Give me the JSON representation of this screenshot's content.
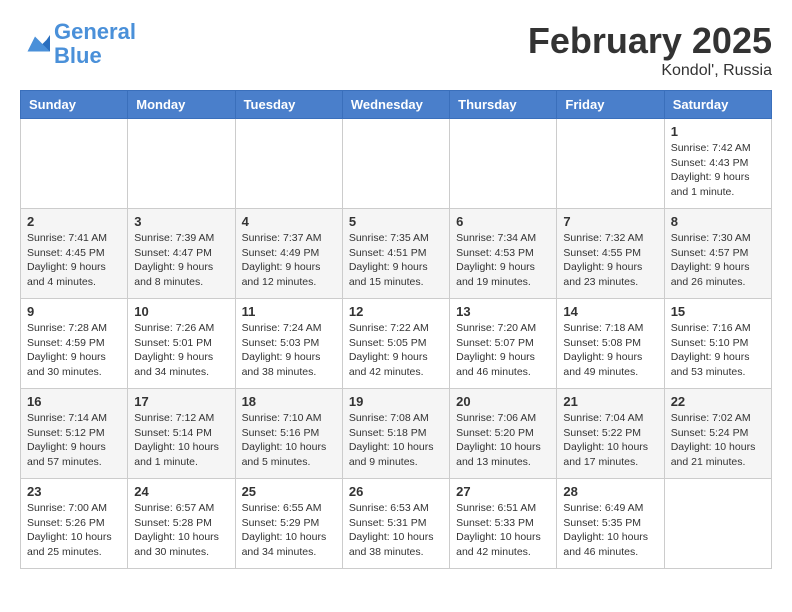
{
  "logo": {
    "line1": "General",
    "line2": "Blue"
  },
  "title": "February 2025",
  "location": "Kondol', Russia",
  "headers": [
    "Sunday",
    "Monday",
    "Tuesday",
    "Wednesday",
    "Thursday",
    "Friday",
    "Saturday"
  ],
  "weeks": [
    [
      {
        "day": "",
        "sunrise": "",
        "sunset": "",
        "daylight": ""
      },
      {
        "day": "",
        "sunrise": "",
        "sunset": "",
        "daylight": ""
      },
      {
        "day": "",
        "sunrise": "",
        "sunset": "",
        "daylight": ""
      },
      {
        "day": "",
        "sunrise": "",
        "sunset": "",
        "daylight": ""
      },
      {
        "day": "",
        "sunrise": "",
        "sunset": "",
        "daylight": ""
      },
      {
        "day": "",
        "sunrise": "",
        "sunset": "",
        "daylight": ""
      },
      {
        "day": "1",
        "sunrise": "Sunrise: 7:42 AM",
        "sunset": "Sunset: 4:43 PM",
        "daylight": "Daylight: 9 hours and 1 minute."
      }
    ],
    [
      {
        "day": "2",
        "sunrise": "Sunrise: 7:41 AM",
        "sunset": "Sunset: 4:45 PM",
        "daylight": "Daylight: 9 hours and 4 minutes."
      },
      {
        "day": "3",
        "sunrise": "Sunrise: 7:39 AM",
        "sunset": "Sunset: 4:47 PM",
        "daylight": "Daylight: 9 hours and 8 minutes."
      },
      {
        "day": "4",
        "sunrise": "Sunrise: 7:37 AM",
        "sunset": "Sunset: 4:49 PM",
        "daylight": "Daylight: 9 hours and 12 minutes."
      },
      {
        "day": "5",
        "sunrise": "Sunrise: 7:35 AM",
        "sunset": "Sunset: 4:51 PM",
        "daylight": "Daylight: 9 hours and 15 minutes."
      },
      {
        "day": "6",
        "sunrise": "Sunrise: 7:34 AM",
        "sunset": "Sunset: 4:53 PM",
        "daylight": "Daylight: 9 hours and 19 minutes."
      },
      {
        "day": "7",
        "sunrise": "Sunrise: 7:32 AM",
        "sunset": "Sunset: 4:55 PM",
        "daylight": "Daylight: 9 hours and 23 minutes."
      },
      {
        "day": "8",
        "sunrise": "Sunrise: 7:30 AM",
        "sunset": "Sunset: 4:57 PM",
        "daylight": "Daylight: 9 hours and 26 minutes."
      }
    ],
    [
      {
        "day": "9",
        "sunrise": "Sunrise: 7:28 AM",
        "sunset": "Sunset: 4:59 PM",
        "daylight": "Daylight: 9 hours and 30 minutes."
      },
      {
        "day": "10",
        "sunrise": "Sunrise: 7:26 AM",
        "sunset": "Sunset: 5:01 PM",
        "daylight": "Daylight: 9 hours and 34 minutes."
      },
      {
        "day": "11",
        "sunrise": "Sunrise: 7:24 AM",
        "sunset": "Sunset: 5:03 PM",
        "daylight": "Daylight: 9 hours and 38 minutes."
      },
      {
        "day": "12",
        "sunrise": "Sunrise: 7:22 AM",
        "sunset": "Sunset: 5:05 PM",
        "daylight": "Daylight: 9 hours and 42 minutes."
      },
      {
        "day": "13",
        "sunrise": "Sunrise: 7:20 AM",
        "sunset": "Sunset: 5:07 PM",
        "daylight": "Daylight: 9 hours and 46 minutes."
      },
      {
        "day": "14",
        "sunrise": "Sunrise: 7:18 AM",
        "sunset": "Sunset: 5:08 PM",
        "daylight": "Daylight: 9 hours and 49 minutes."
      },
      {
        "day": "15",
        "sunrise": "Sunrise: 7:16 AM",
        "sunset": "Sunset: 5:10 PM",
        "daylight": "Daylight: 9 hours and 53 minutes."
      }
    ],
    [
      {
        "day": "16",
        "sunrise": "Sunrise: 7:14 AM",
        "sunset": "Sunset: 5:12 PM",
        "daylight": "Daylight: 9 hours and 57 minutes."
      },
      {
        "day": "17",
        "sunrise": "Sunrise: 7:12 AM",
        "sunset": "Sunset: 5:14 PM",
        "daylight": "Daylight: 10 hours and 1 minute."
      },
      {
        "day": "18",
        "sunrise": "Sunrise: 7:10 AM",
        "sunset": "Sunset: 5:16 PM",
        "daylight": "Daylight: 10 hours and 5 minutes."
      },
      {
        "day": "19",
        "sunrise": "Sunrise: 7:08 AM",
        "sunset": "Sunset: 5:18 PM",
        "daylight": "Daylight: 10 hours and 9 minutes."
      },
      {
        "day": "20",
        "sunrise": "Sunrise: 7:06 AM",
        "sunset": "Sunset: 5:20 PM",
        "daylight": "Daylight: 10 hours and 13 minutes."
      },
      {
        "day": "21",
        "sunrise": "Sunrise: 7:04 AM",
        "sunset": "Sunset: 5:22 PM",
        "daylight": "Daylight: 10 hours and 17 minutes."
      },
      {
        "day": "22",
        "sunrise": "Sunrise: 7:02 AM",
        "sunset": "Sunset: 5:24 PM",
        "daylight": "Daylight: 10 hours and 21 minutes."
      }
    ],
    [
      {
        "day": "23",
        "sunrise": "Sunrise: 7:00 AM",
        "sunset": "Sunset: 5:26 PM",
        "daylight": "Daylight: 10 hours and 25 minutes."
      },
      {
        "day": "24",
        "sunrise": "Sunrise: 6:57 AM",
        "sunset": "Sunset: 5:28 PM",
        "daylight": "Daylight: 10 hours and 30 minutes."
      },
      {
        "day": "25",
        "sunrise": "Sunrise: 6:55 AM",
        "sunset": "Sunset: 5:29 PM",
        "daylight": "Daylight: 10 hours and 34 minutes."
      },
      {
        "day": "26",
        "sunrise": "Sunrise: 6:53 AM",
        "sunset": "Sunset: 5:31 PM",
        "daylight": "Daylight: 10 hours and 38 minutes."
      },
      {
        "day": "27",
        "sunrise": "Sunrise: 6:51 AM",
        "sunset": "Sunset: 5:33 PM",
        "daylight": "Daylight: 10 hours and 42 minutes."
      },
      {
        "day": "28",
        "sunrise": "Sunrise: 6:49 AM",
        "sunset": "Sunset: 5:35 PM",
        "daylight": "Daylight: 10 hours and 46 minutes."
      },
      {
        "day": "",
        "sunrise": "",
        "sunset": "",
        "daylight": ""
      }
    ]
  ]
}
